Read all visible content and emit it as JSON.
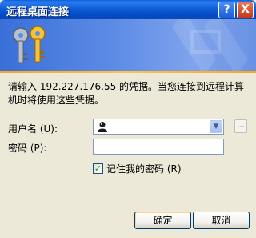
{
  "window": {
    "title": "远程桌面连接",
    "help_label": "?",
    "close_label": "X"
  },
  "description": "请输入 192.227.176.55 的凭据。当您连接到远程计算机时将使用这些凭据。",
  "username": {
    "label": "用户名 (U):",
    "value": ""
  },
  "password": {
    "label": "密码 (P):",
    "value": ""
  },
  "remember": {
    "label": "记住我的密码 (R)",
    "checked": true
  },
  "buttons": {
    "ok": "确定",
    "cancel": "取消"
  },
  "colors": {
    "titlebar": "#0A5AD4",
    "banner": "#5D8CE6",
    "accent": "#F5A623",
    "window_bg": "#ECE9D8"
  }
}
